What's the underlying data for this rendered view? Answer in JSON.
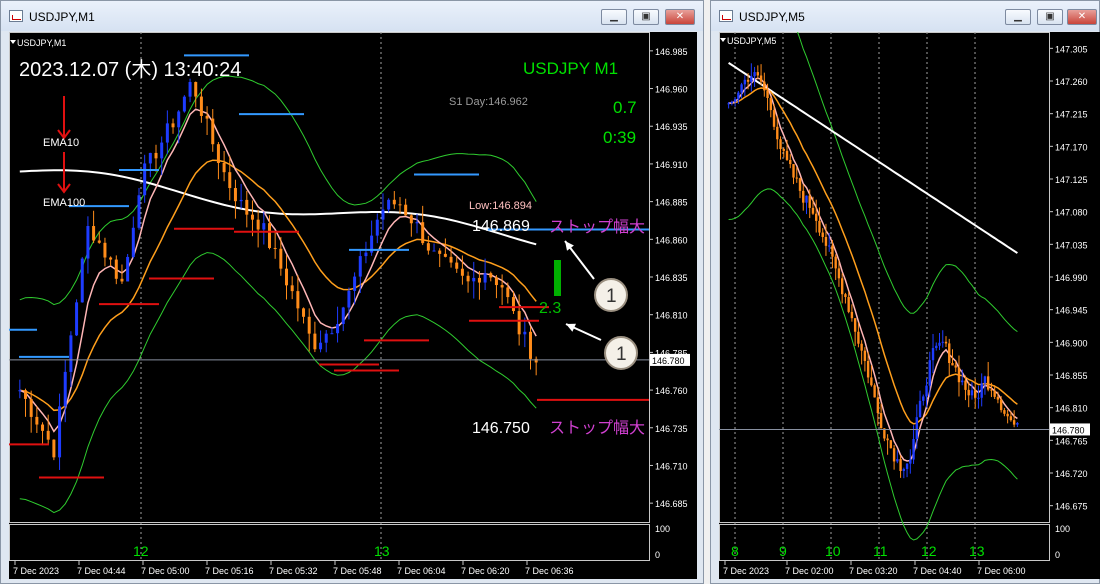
{
  "windows": [
    {
      "title": "USDJPY,M1",
      "min_btn": "▁",
      "max_btn": "▣",
      "close_btn": "✕"
    },
    {
      "title": "USDJPY,M5",
      "min_btn": "▁",
      "max_btn": "▣",
      "close_btn": "✕"
    }
  ],
  "m1": {
    "chart_label": "USDJPY,M1",
    "clock": "2023.12.07 (木) 13:40:24",
    "symbol_tf": "USDJPY  M1",
    "spread": "0.7",
    "timer": "0:39",
    "s1_day": "S1 Day:146.962",
    "low_label": "Low:146.894",
    "ema10": "EMA10",
    "ema100": "EMA100",
    "level_high": "146.869",
    "level_low": "146.750",
    "stop_text": "ストップ幅大",
    "bar_value": "2.3",
    "circle_label": "1",
    "current_price": "146.780",
    "price_ticks": [
      "146.985",
      "146.960",
      "146.935",
      "146.910",
      "146.885",
      "146.860",
      "146.835",
      "146.810",
      "146.785",
      "146.760",
      "146.735",
      "146.710",
      "146.685"
    ],
    "sub_ticks": [
      "100",
      "0"
    ],
    "hour_labels": [
      "12",
      "13"
    ],
    "time_labels": [
      "7 Dec 2023",
      "7 Dec 04:44",
      "7 Dec 05:00",
      "7 Dec 05:16",
      "7 Dec 05:32",
      "7 Dec 05:48",
      "7 Dec 06:04",
      "7 Dec 06:20",
      "7 Dec 06:36"
    ]
  },
  "m5": {
    "chart_label": "USDJPY,M5",
    "current_price": "146.780",
    "price_ticks": [
      "147.305",
      "147.260",
      "147.215",
      "147.170",
      "147.125",
      "147.080",
      "147.035",
      "146.990",
      "146.945",
      "146.900",
      "146.855",
      "146.810",
      "146.765",
      "146.720",
      "146.675"
    ],
    "sub_ticks": [
      "100",
      "0"
    ],
    "hour_labels": [
      "8",
      "9",
      "10",
      "11",
      "12",
      "13"
    ],
    "time_labels": [
      "7 Dec 2023",
      "7 Dec 02:00",
      "7 Dec 03:20",
      "7 Dec 04:40",
      "7 Dec 06:00"
    ]
  },
  "colors": {
    "bull": "#1e3cff",
    "bear": "#ff8c1a",
    "ema_fast": "#ffb6b6",
    "ema_slow": "#ffffff",
    "ma_mid": "#ff9f1c",
    "band": "#2fcc2f",
    "green_text": "#00e000",
    "magenta": "#d040d0",
    "red": "#e01010",
    "blue_line": "#3399ff"
  }
}
